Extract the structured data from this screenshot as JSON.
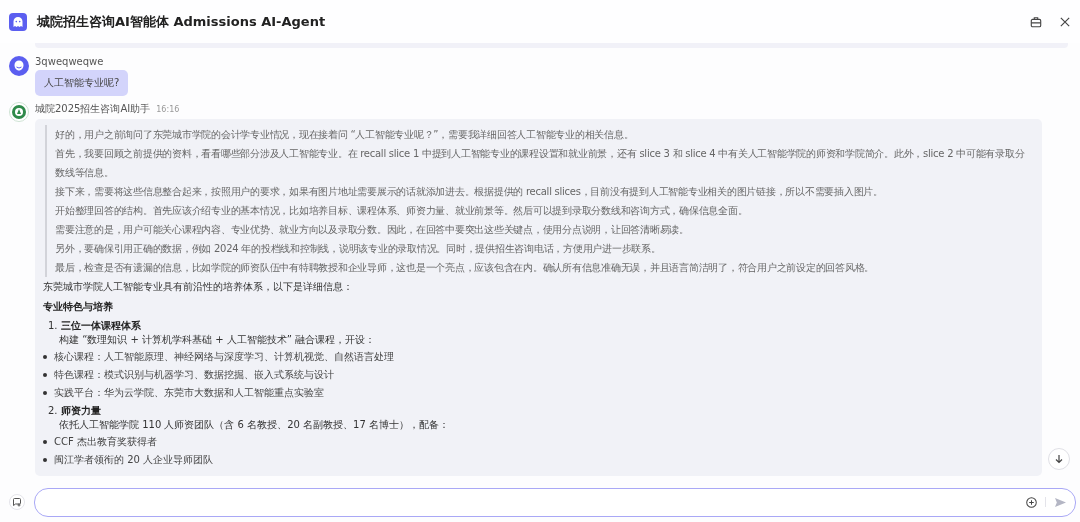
{
  "header": {
    "title": "城院招生咨询AI智能体 Admissions AI-Agent"
  },
  "user_message": {
    "sender": "3qweqweqwe",
    "text": "人工智能专业呢?"
  },
  "bot_message": {
    "sender": "城院2025招生咨询AI助手",
    "time": "16:16",
    "reasoning": [
      "好的，用户之前询问了东莞城市学院的会计学专业情况，现在接着问 “人工智能专业呢？”，需要我详细回答人工智能专业的相关信息。",
      "首先，我要回顾之前提供的资料，看看哪些部分涉及人工智能专业。在 recall slice 1 中提到人工智能专业的课程设置和就业前景，还有 slice 3 和 slice 4 中有关人工智能学院的师资和学院简介。此外，slice 2 中可能有录取分数线等信息。",
      "接下来，需要将这些信息整合起来，按照用户的要求，如果有图片地址需要展示的话就添加进去。根据提供的 recall slices，目前没有提到人工智能专业相关的图片链接，所以不需要插入图片。",
      "开始整理回答的结构。首先应该介绍专业的基本情况，比如培养目标、课程体系、师资力量、就业前景等。然后可以提到录取分数线和咨询方式，确保信息全面。",
      "需要注意的是，用户可能关心课程内容、专业优势、就业方向以及录取分数。因此，在回答中要突出这些关键点，使用分点说明，让回答清晰易读。",
      "另外，要确保引用正确的数据，例如 2024 年的投档线和控制线，说明该专业的录取情况。同时，提供招生咨询电话，方便用户进一步联系。",
      "最后，检查是否有遗漏的信息，比如学院的师资队伍中有特聘教授和企业导师，这也是一个亮点，应该包含在内。确认所有信息准确无误，并且语言简洁明了，符合用户之前设定的回答风格。"
    ],
    "intro": "东莞城市学院人工智能专业具有前沿性的培养体系，以下是详细信息：",
    "heading": "专业特色与培养",
    "sections": [
      {
        "number": "1.",
        "title": "三位一体课程体系",
        "description": "构建 “数理知识 + 计算机学科基础 + 人工智能技术” 融合课程，开设：",
        "bullets": [
          "核心课程：人工智能原理、神经网络与深度学习、计算机视觉、自然语言处理",
          "特色课程：模式识别与机器学习、数据挖掘、嵌入式系统与设计",
          "实践平台：华为云学院、东莞市大数据和人工智能重点实验室"
        ]
      },
      {
        "number": "2.",
        "title": "师资力量",
        "description": "依托人工智能学院 110 人师资团队（含 6 名教授、20 名副教授、17 名博士），配备：",
        "bullets": [
          "CCF 杰出教育奖获得者",
          "闽江学者领衔的 20 人企业导师团队"
        ]
      }
    ]
  }
}
